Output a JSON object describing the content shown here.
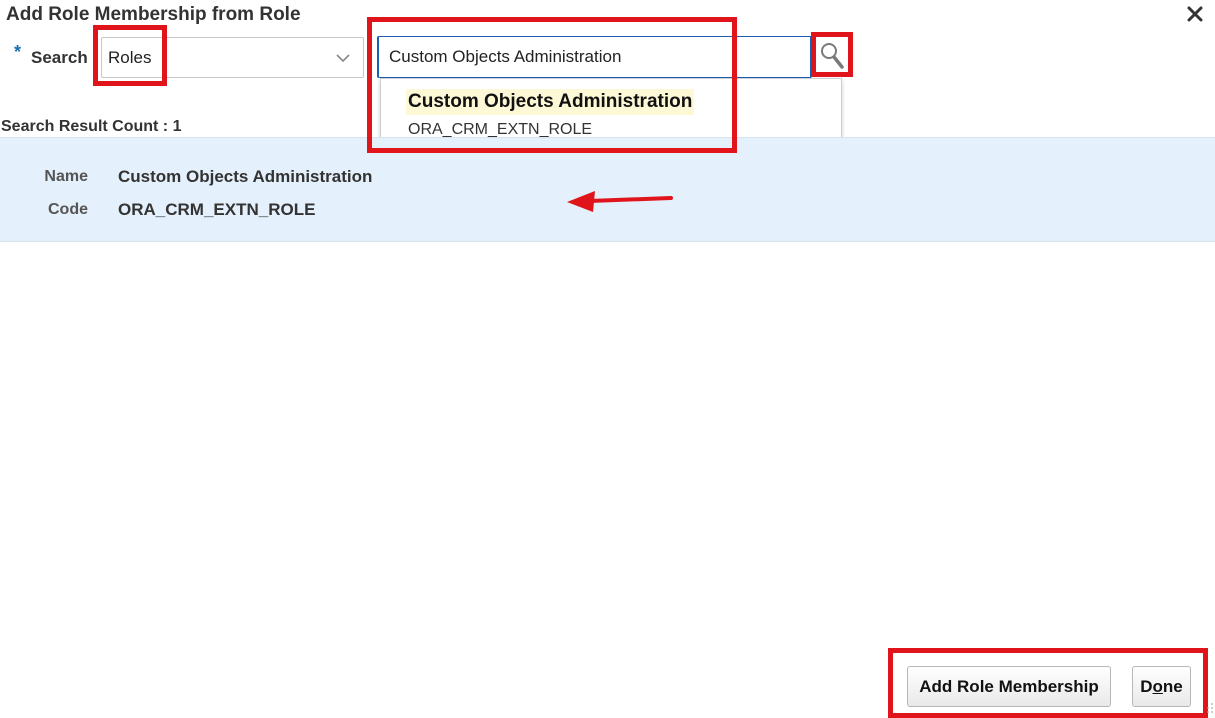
{
  "dialog": {
    "title": "Add Role Membership from Role"
  },
  "search": {
    "required_marker": "*",
    "label": "Search",
    "type_selected": "Roles",
    "query_value": "Custom Objects Administration"
  },
  "suggestion": {
    "name": "Custom Objects Administration",
    "code": "ORA_CRM_EXTN_ROLE"
  },
  "results": {
    "count_label": "Search Result Count : 1",
    "name_label": "Name",
    "name_value": "Custom Objects Administration",
    "code_label": "Code",
    "code_value": "ORA_CRM_EXTN_ROLE"
  },
  "buttons": {
    "add_label": "Add Role Membership",
    "done_prefix": "D",
    "done_mnemonic": "o",
    "done_suffix": "ne"
  },
  "colors": {
    "annotation": "#e0141b",
    "result_bg": "#e4f0fb",
    "input_border": "#1a5fb4",
    "highlight": "#fdf8d6"
  }
}
